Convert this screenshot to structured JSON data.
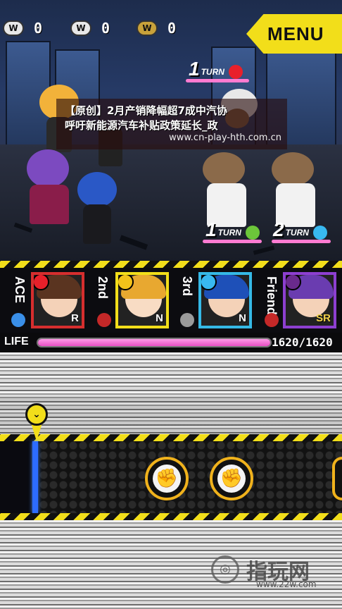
{
  "currencies": [
    {
      "icon": "W",
      "value": "0"
    },
    {
      "icon": "W",
      "value": "0"
    },
    {
      "icon": "W",
      "value": "0"
    }
  ],
  "menu_label": "MENU",
  "turns": [
    {
      "num": "1",
      "label": "TURN",
      "element": "fire",
      "color": "#e8202a"
    },
    {
      "num": "1",
      "label": "TURN",
      "element": "leaf",
      "color": "#6cc63a"
    },
    {
      "num": "2",
      "label": "TURN",
      "element": "water",
      "color": "#38b8f0"
    }
  ],
  "banner": {
    "line1": "【原创】2月产销降幅超7成中汽协",
    "line2": "呼吁新能源汽车补贴政策延长_政",
    "url": "www.cn-play-hth.com.cn"
  },
  "party": [
    {
      "slot": "ACE",
      "rarity": "R",
      "element": "fire",
      "frame": "#d62e2e",
      "sub": "sword"
    },
    {
      "slot": "2nd",
      "rarity": "N",
      "element": "thunder",
      "frame": "#f2de1a",
      "sub": "fist"
    },
    {
      "slot": "3rd",
      "rarity": "N",
      "element": "water",
      "frame": "#35b9e6",
      "sub": "gun"
    },
    {
      "slot": "Friend",
      "rarity": "SR",
      "element": "dark",
      "frame": "#8d3fd0",
      "sub": "fist"
    }
  ],
  "life": {
    "label": "LIFE",
    "current": 1620,
    "max": 1620,
    "text": "1620/1620"
  },
  "timeline": {
    "marker": "⌄",
    "actions": [
      "fist",
      "fist",
      "fist"
    ]
  },
  "watermark": {
    "name": "指玩网",
    "url": "www.22w.com"
  }
}
